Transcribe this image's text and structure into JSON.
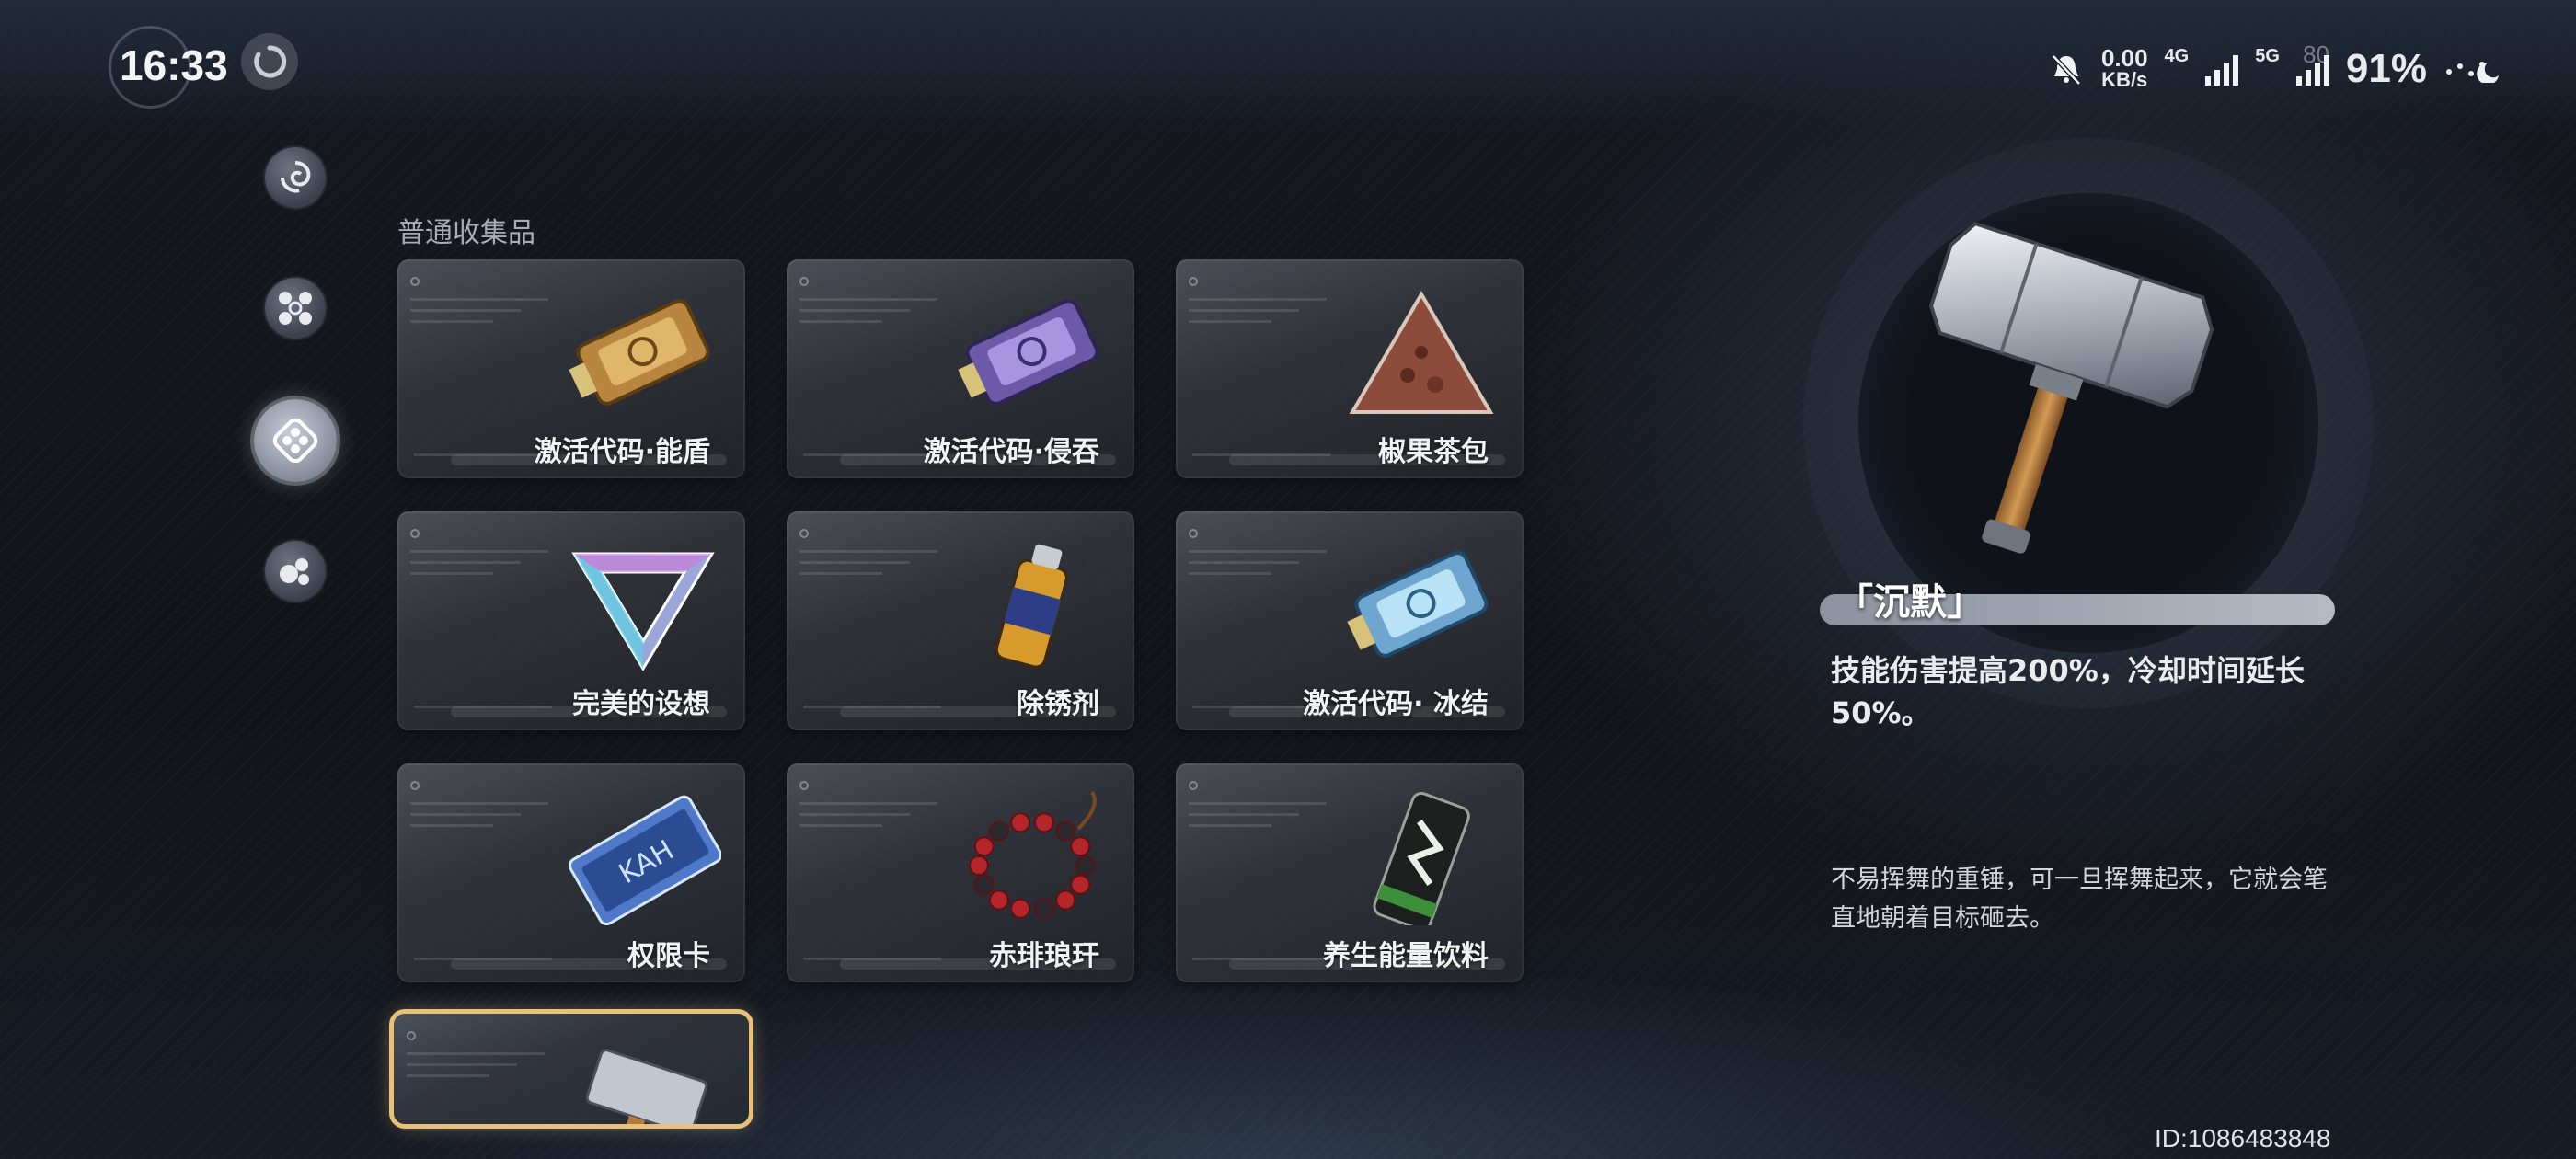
{
  "status_bar": {
    "time": "16:33",
    "net_speed_value": "0.00",
    "net_speed_unit": "KB/s",
    "network_4g": "4G",
    "network_5g": "5G",
    "battery": "91%",
    "corner_number": "80"
  },
  "nav": {
    "items": [
      {
        "icon": "swirl-icon",
        "active": false
      },
      {
        "icon": "nodes-icon",
        "active": false
      },
      {
        "icon": "collection-icon",
        "active": true
      },
      {
        "icon": "bubbles-icon",
        "active": false
      }
    ]
  },
  "section": {
    "title": "普通收集品"
  },
  "collectibles": [
    {
      "label": "激活代码·能盾",
      "icon": "gold-activation-chip-icon",
      "selected": false
    },
    {
      "label": "激活代码·侵吞",
      "icon": "purple-activation-chip-icon",
      "selected": false
    },
    {
      "label": "椒果茶包",
      "icon": "tea-bag-icon",
      "selected": false
    },
    {
      "label": "完美的设想",
      "icon": "penrose-triangle-icon",
      "selected": false
    },
    {
      "label": "除锈剂",
      "icon": "spray-can-icon",
      "selected": false
    },
    {
      "label": "激活代码· 冰结",
      "icon": "blue-activation-chip-icon",
      "selected": false
    },
    {
      "label": "权限卡",
      "icon": "access-card-icon",
      "selected": false
    },
    {
      "label": "赤琲琅玕",
      "icon": "bead-bracelet-icon",
      "selected": false
    },
    {
      "label": "养生能量饮料",
      "icon": "energy-drink-can-icon",
      "selected": false
    },
    {
      "label": "",
      "icon": "hammer-icon",
      "selected": true
    }
  ],
  "detail": {
    "name": "「沉默」",
    "effect": "技能伤害提高200%，冷却时间延长50%。",
    "description": "不易挥舞的重锤，可一旦挥舞起来，它就会笔直地朝着目标砸去。",
    "icon": "hammer-icon"
  },
  "footer": {
    "user_id": "ID:1086483848"
  },
  "colors": {
    "selected_border": "#e7c07a",
    "name_bar": "#b5bac4"
  }
}
